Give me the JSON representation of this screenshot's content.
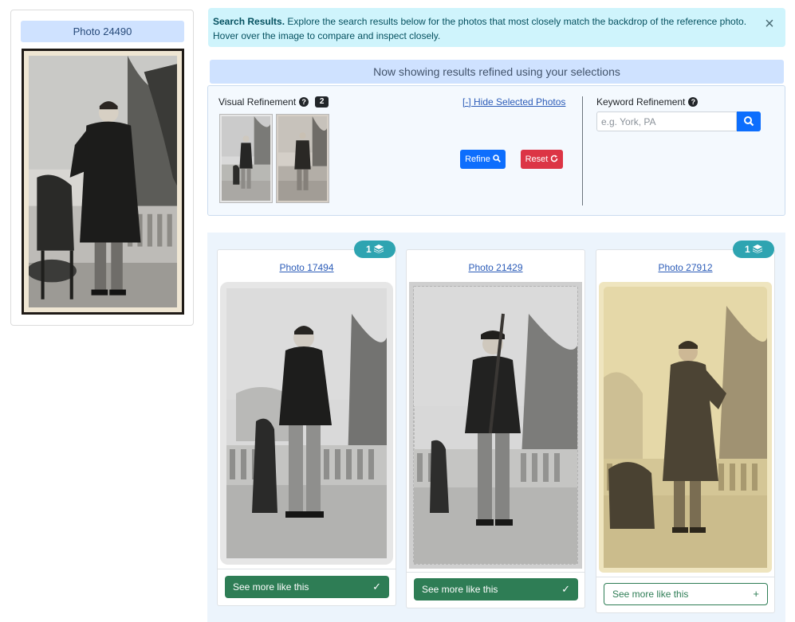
{
  "reference": {
    "title": "Photo 24490"
  },
  "alert": {
    "title": "Search Results.",
    "message": "Explore the search results below for the photos that most closely match the backdrop of the reference photo. Hover over the image to compare and inspect closely.",
    "close_icon": "close-icon"
  },
  "refinement": {
    "banner": "Now showing results refined using your selections",
    "visual_label": "Visual Refinement",
    "help_icon": "?",
    "selected_count": "2",
    "hide_link": "[-] Hide Selected Photos",
    "refine_label": "Refine",
    "reset_label": "Reset",
    "keyword_label": "Keyword Refinement",
    "keyword_placeholder": "e.g. York, PA",
    "keyword_value": ""
  },
  "results": [
    {
      "title": "Photo 17494",
      "see_more": "See more like this",
      "selected": true,
      "stack_count": "1"
    },
    {
      "title": "Photo 21429",
      "see_more": "See more like this",
      "selected": true,
      "stack_count": ""
    },
    {
      "title": "Photo 27912",
      "see_more": "See more like this",
      "selected": false,
      "stack_count": "1"
    }
  ],
  "colors": {
    "primary": "#0d6efd",
    "danger": "#dc3545",
    "success": "#2e7d55",
    "info_badge": "#2ea4b1",
    "alert_bg": "#cff4fc"
  }
}
